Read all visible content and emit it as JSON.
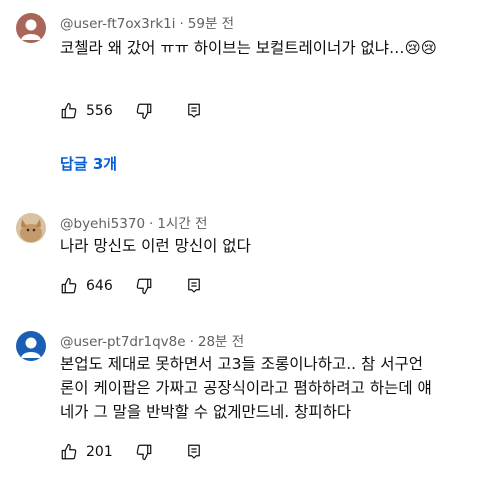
{
  "comments": [
    {
      "author": "@user-ft7ox3rk1i",
      "time": "59분 전",
      "text": "코첼라 왜 갔어 ㅠㅠ 하이브는 보컬트레이너가 없냐…😢😢",
      "likes": "556",
      "avatar_color": "#a9655a"
    },
    {
      "author": "@byehi5370",
      "time": "1시간 전",
      "text": "나라 망신도 이런 망신이 없다",
      "likes": "646",
      "avatar_color": "#c9a77c"
    },
    {
      "author": "@user-pt7dr1qv8e",
      "time": "28분 전",
      "text_lines": [
        "본업도 제대로 못하면서 고3들 조롱이나하고.. 참 서구언",
        "론이 케이팝은 가짜고 공장식이라고 폄하하려고 하는데 얘",
        "네가 그 말을 반박할 수 없게만드네. 창피하다"
      ],
      "likes": "201",
      "avatar_color": "#1a5fb4"
    }
  ],
  "replies_label": "답글 3개",
  "dot": "·",
  "icons": [
    "thumbs-up-icon",
    "thumbs-down-icon",
    "reply-icon"
  ],
  "accent_color": "#065fd4"
}
